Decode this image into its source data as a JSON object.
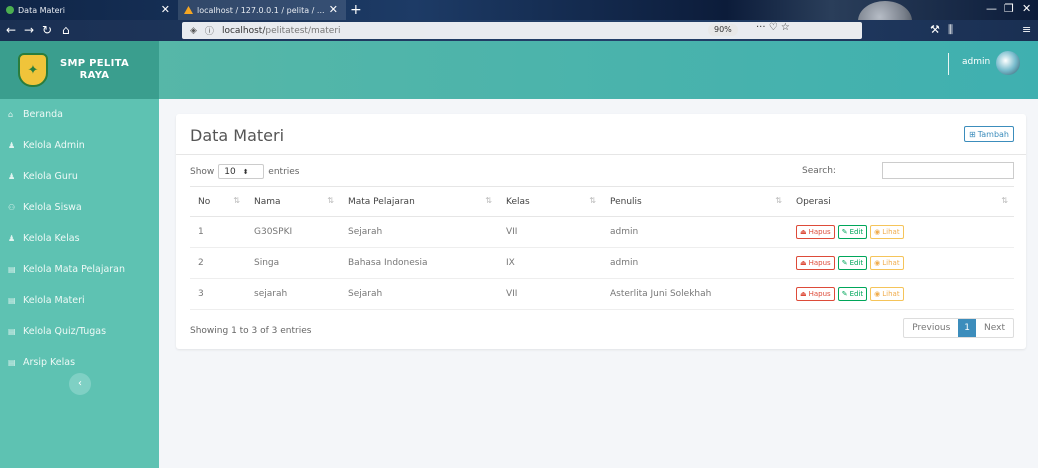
{
  "browser": {
    "tabs": [
      {
        "label": "Data Materi"
      },
      {
        "label": "localhost / 127.0.0.1 / pelita / ..."
      }
    ],
    "url_prefix": "localhost/",
    "url_path": "pelitatest/materi",
    "zoom": "90%"
  },
  "brand": {
    "line1": "SMP PELITA",
    "line2": "RAYA"
  },
  "user": {
    "name": "admin"
  },
  "sidebar": {
    "items": [
      {
        "label": "Beranda"
      },
      {
        "label": "Kelola Admin"
      },
      {
        "label": "Kelola Guru"
      },
      {
        "label": "Kelola Siswa"
      },
      {
        "label": "Kelola Kelas"
      },
      {
        "label": "Kelola Mata Pelajaran"
      },
      {
        "label": "Kelola Materi"
      },
      {
        "label": "Kelola Quiz/Tugas"
      },
      {
        "label": "Arsip Kelas"
      }
    ]
  },
  "card": {
    "title": "Data Materi",
    "add_label": "Tambah",
    "show_label": "Show",
    "page_length": "10",
    "entries_label": "entries",
    "search_label": "Search:"
  },
  "table": {
    "headers": [
      "No",
      "Nama",
      "Mata Pelajaran",
      "Kelas",
      "Penulis",
      "Operasi"
    ],
    "rows": [
      {
        "no": "1",
        "nama": "G30SPKI",
        "mapel": "Sejarah",
        "kelas": "VII",
        "penulis": "admin"
      },
      {
        "no": "2",
        "nama": "Singa",
        "mapel": "Bahasa Indonesia",
        "kelas": "IX",
        "penulis": "admin"
      },
      {
        "no": "3",
        "nama": "sejarah",
        "mapel": "Sejarah",
        "kelas": "VII",
        "penulis": "Asterlita Juni Solekhah"
      }
    ],
    "actions": {
      "hapus": "Hapus",
      "edit": "Edit",
      "lihat": "Lihat"
    }
  },
  "footer": {
    "info": "Showing 1 to 3 of 3 entries",
    "previous": "Previous",
    "page": "1",
    "next": "Next"
  },
  "colors": {
    "sidebar": "#5ec2b2",
    "header": "#4fb5ab",
    "primary": "#3c8dbc",
    "danger": "#dd4b39",
    "success": "#00a65a",
    "warning": "#f0ad4e"
  }
}
